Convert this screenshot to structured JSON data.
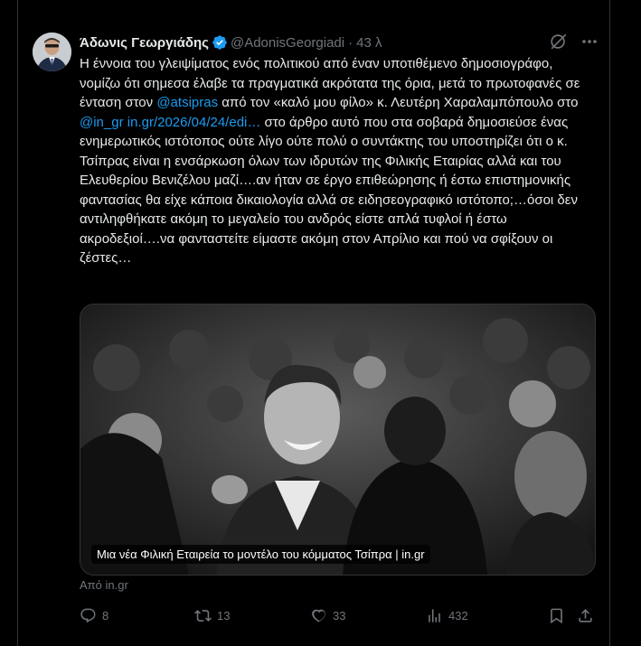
{
  "author": {
    "name": "Άδωνις Γεωργιάδης",
    "handle": "@AdonisGeorgiadi",
    "separator": "·",
    "time": "43 λ",
    "verified_icon": "verified-badge-icon"
  },
  "tweet": {
    "text_parts": [
      "Η έννοια του γλειψίματος ενός πολιτικού από έναν υποτιθέμενο δημοσιογράφο, νομίζω ότι σημεσα έλαβε τα πραγματικά ακρότατα της όρια, μετά το πρωτοφανές σε ένταση στον ",
      "@atsipras",
      " από τον «καλό μου φίλο» κ. Λευτέρη Χαραλαμπόπουλο στο ",
      "@in_gr",
      " ",
      "in.gr/2026/04/24/edi…",
      " στο άρθρο αυτό που στα σοβαρά δημοσιεύσε ένας ενημερωτικός ιστότοπος ούτε λίγο ούτε πολύ ο συντάκτης του υποστηρίζει ότι ο κ. Τσίπρας είναι η ενσάρκωση όλων των ιδρυτών της Φιλικής Εταιρίας αλλά και του Ελευθερίου Βενιζέλου μαζί….αν ήταν σε έργο επιθεώρησης ή έστω επιστημονικής φαντασίας θα είχε κάποια δικαιολογία αλλά σε ειδησεογραφικό ιστότοπο;…όσοι δεν αντιληφθήκατε ακόμη το μεγαλείο του ανδρός είστε απλά τυφλοί ή έστω ακροδεξιοί….να φανταστείτε είμαστε ακόμη στον Απρίλιο και πού να σφίξουν οι ζέστες…"
    ]
  },
  "card": {
    "caption": "Μια νέα Φιλική Εταιρεία το μοντέλο του κόμματος Τσίπρα | in.gr",
    "source": "Από in.gr"
  },
  "actions": {
    "replies": "8",
    "reposts": "13",
    "likes": "33",
    "views": "432"
  },
  "colors": {
    "background": "#000000",
    "text": "#e7e9ea",
    "muted": "#71767b",
    "link": "#1d9bf0"
  }
}
